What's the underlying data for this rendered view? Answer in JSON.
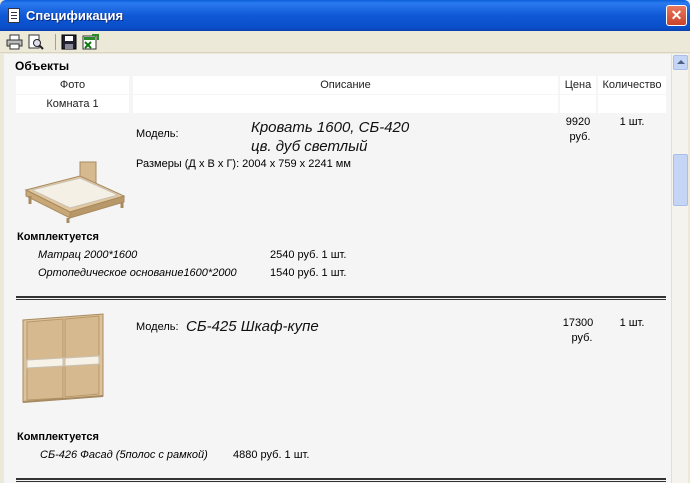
{
  "window": {
    "title": "Спецификация",
    "close_glyph": "✕"
  },
  "toolbar": {
    "buttons": [
      "print-icon",
      "print-preview-icon",
      "save-icon",
      "excel-export-icon"
    ]
  },
  "section_title": "Объекты",
  "table_headers": {
    "photo": "Фото",
    "description": "Описание",
    "price": "Цена",
    "quantity": "Количество"
  },
  "room": "Комната 1",
  "items": [
    {
      "model_label": "Модель:",
      "name_line1": "Кровать 1600, СБ-420",
      "name_line2": "цв. дуб светлый",
      "dimensions": "Размеры (Д х В х Г): 2004 х 759 х 2241 мм",
      "price": "9920",
      "price_unit": "руб.",
      "qty": "1 шт.",
      "kit_title": "Комплектуется",
      "kit": [
        {
          "name": "Матрац 2000*1600",
          "price": "2540 руб. 1 шт."
        },
        {
          "name": "Ортопедическое основание1600*2000",
          "price": "1540 руб. 1 шт."
        }
      ]
    },
    {
      "model_label": "Модель:",
      "name": "СБ-425 Шкаф-купе",
      "price": "17300",
      "price_unit": "руб.",
      "qty": "1 шт.",
      "kit_title": "Комплектуется",
      "kit": [
        {
          "name": "СБ-426 Фасад (5полос с рамкой)",
          "price": "4880 руб. 1 шт."
        }
      ]
    }
  ]
}
